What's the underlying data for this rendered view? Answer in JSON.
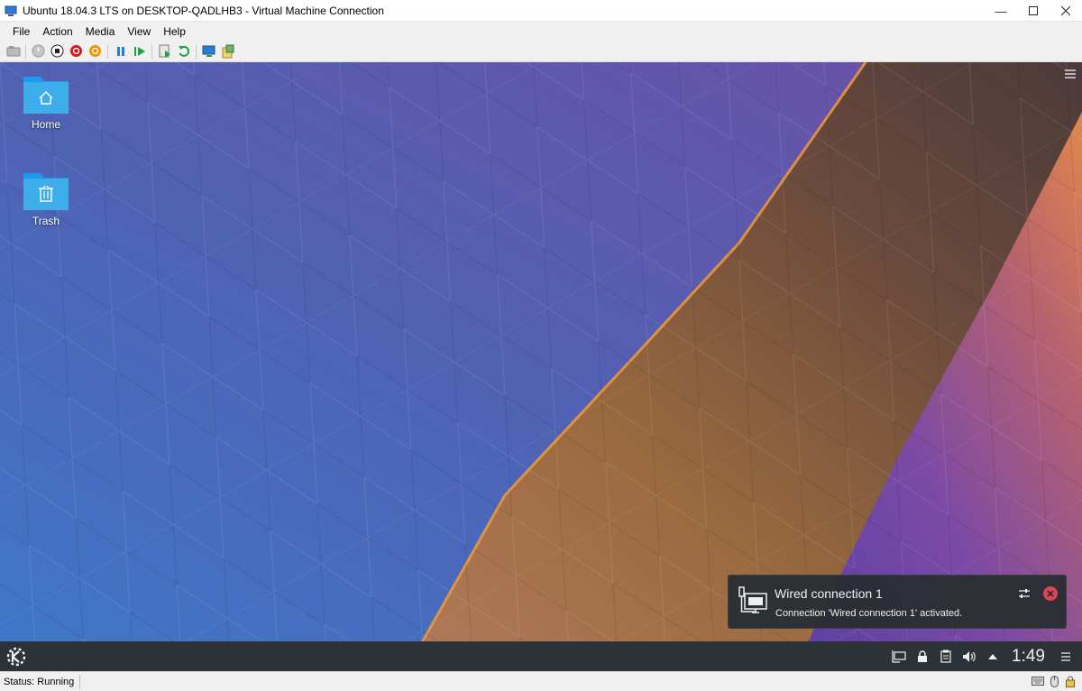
{
  "window": {
    "title": "Ubuntu 18.04.3 LTS on DESKTOP-QADLHB3 - Virtual Machine Connection",
    "controls": [
      "minimize-icon",
      "maximize-icon",
      "close-icon"
    ]
  },
  "menubar": {
    "items": [
      "File",
      "Action",
      "Media",
      "View",
      "Help"
    ]
  },
  "toolbar": {
    "buttons": [
      "ctrl-alt-del-icon",
      "start-icon",
      "turn-off-icon",
      "shut-down-icon",
      "save-icon",
      "pause-icon",
      "resume-icon",
      "checkpoint-icon",
      "revert-icon",
      "enhanced-session-icon",
      "share-icon"
    ]
  },
  "desktop": {
    "icons": [
      {
        "label": "Home",
        "icon": "home-icon"
      },
      {
        "label": "Trash",
        "icon": "trash-icon"
      }
    ]
  },
  "notification": {
    "title": "Wired connection 1",
    "body": "Connection 'Wired connection 1' activated.",
    "icon": "network-wired-icon"
  },
  "panel": {
    "clock": "1:49",
    "tray": [
      "network-icon",
      "lock-icon",
      "clipboard-icon",
      "volume-icon",
      "expand-arrow-icon"
    ]
  },
  "statusbar": {
    "status": "Status: Running"
  },
  "colors": {
    "panel_bg": "#2d3237",
    "notification_bg": "#2a2e32",
    "folder_blue": "#3daee9",
    "close_red": "#da4453"
  }
}
